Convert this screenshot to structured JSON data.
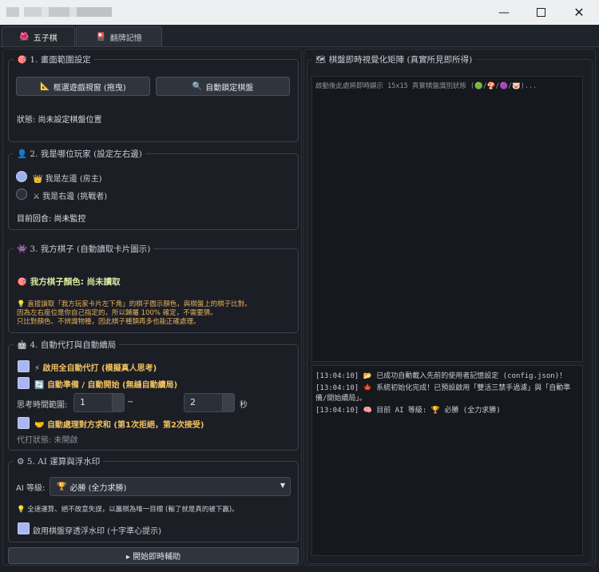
{
  "window": {
    "minimize_icon": "minimize-icon",
    "maximize_icon": "maximize-icon",
    "close_icon": "close-icon"
  },
  "tabs": [
    {
      "label": "五子棋",
      "icon": "🌺"
    },
    {
      "label": "翻牌記憶",
      "icon": "🎴"
    }
  ],
  "section1": {
    "title": "1. 畫面範圍設定",
    "icon": "🎯",
    "btn_select": "框選遊戲視窗 (拖曳)",
    "btn_auto": "自動鎖定棋盤",
    "status": "狀態: 尚未設定棋盤位置"
  },
  "section2": {
    "title": "2. 我是哪位玩家 (設定左右邊)",
    "icon": "👤",
    "left_player": "我是左邊 (房主)",
    "right_player": "我是右邊 (挑戰者)",
    "current_round": "目前回合: 尚未監控"
  },
  "section3": {
    "title": "3. 我方棋子 (自動讀取卡片圖示)",
    "icon": "👾",
    "color_label": "我方棋子顏色: 尚未讀取",
    "hint_line1": "直接讀取「我方玩家卡片左下角」的棋子圖示顏色，與棋盤上的棋子比對。",
    "hint_line2": "因為左右座位是你自己指定的，所以歸屬 100% 確定，不需要猜。",
    "hint_line3": "只比對顏色、不辨識物種，因此棋子種類再多也能正確處理。"
  },
  "section4": {
    "title": "4. 自動代打與自動續局",
    "icon": "🤖",
    "auto_play": "啟用全自動代打 (模擬真人思考)",
    "auto_ready": "自動準備 / 自動開始 (無縫自動續局)",
    "think_label": "思考時間範圍:",
    "think_min": "1",
    "tilde": "~",
    "think_max": "2",
    "seconds": "秒",
    "auto_draw": "自動處理對方求和 (第1次拒絕，第2次接受)",
    "status": "代打狀態: 未開啟"
  },
  "section5": {
    "title": "5. AI 運算與浮水印",
    "icon": "⚙",
    "level_label": "AI 等級:",
    "level_value": "必勝 (全力求勝)",
    "level_hint": "全速運算、絕不故意失誤，以贏棋為唯一目標 (輸了就是真的被下贏)。",
    "watermark": "啟用棋盤穿透浮水印 (十字準心提示)"
  },
  "start_button": "▸ 開始即時輔助",
  "matrix": {
    "title": "棋盤即時視覺化矩陣 (真實所見即所得)",
    "icon": "🗺",
    "placeholder": "啟動後此處將即時顯示 15x15 真實棋盤識別狀態 (🟢/🍄/🟣/🐷)..."
  },
  "logs": [
    {
      "time": "[13:04:10]",
      "icon": "📂",
      "text": "已成功自動載入先前的使用者記憶設定 (config.json)！"
    },
    {
      "time": "[13:04:10]",
      "icon": "🍁",
      "text": "系統初始化完成！已預設啟用「雙活三禁手過濾」與「自動準",
      "text2": "備/開始續局」。"
    },
    {
      "time": "[13:04:10]",
      "icon": "🧠",
      "text": "目前 AI 等級: 🏆 必勝 (全力求勝)"
    }
  ],
  "colors": {
    "accent_check": "#aab6f2",
    "status_orange": "#f0c060",
    "title_green": "#d8e8a0",
    "hint_orange": "#e8b060"
  }
}
